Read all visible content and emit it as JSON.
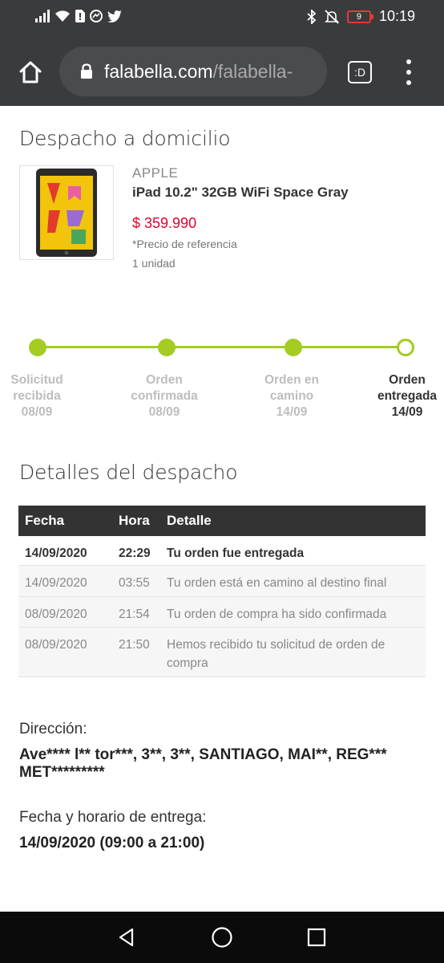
{
  "status_bar": {
    "time": "10:19",
    "battery": "9",
    "left_icons": [
      "signal-icon",
      "wifi-icon",
      "sim-icon",
      "messenger-icon",
      "twitter-icon"
    ],
    "right_icons": [
      "bluetooth-icon",
      "mute-icon",
      "battery-icon"
    ]
  },
  "browser": {
    "url_host": "falabella.com",
    "url_path": "/falabella-",
    "tabs_label": ":D"
  },
  "page": {
    "title": "Despacho a domicilio",
    "product": {
      "brand": "APPLE",
      "name": "iPad 10.2\" 32GB WiFi Space Gray",
      "price": "$ 359.990",
      "price_note": "*Precio de referencia",
      "quantity": "1 unidad"
    },
    "tracker": {
      "steps": [
        {
          "label1": "Solicitud",
          "label2": "recibida",
          "date": "08/09",
          "done": true
        },
        {
          "label1": "Orden",
          "label2": "confirmada",
          "date": "08/09",
          "done": true
        },
        {
          "label1": "Orden en",
          "label2": "camino",
          "date": "14/09",
          "done": true
        },
        {
          "label1": "Orden",
          "label2": "entregada",
          "date": "14/09",
          "done": false
        }
      ]
    },
    "details_title": "Detalles del despacho",
    "table": {
      "headers": {
        "fecha": "Fecha",
        "hora": "Hora",
        "detalle": "Detalle"
      },
      "rows": [
        {
          "fecha": "14/09/2020",
          "hora": "22:29",
          "detalle": "Tu orden fue entregada"
        },
        {
          "fecha": "14/09/2020",
          "hora": "03:55",
          "detalle": "Tu orden está en camino al destino final"
        },
        {
          "fecha": "08/09/2020",
          "hora": "21:54",
          "detalle": "Tu orden de compra ha sido confirmada"
        },
        {
          "fecha": "08/09/2020",
          "hora": "21:50",
          "detalle": "Hemos recibido tu solicitud de orden de compra"
        }
      ]
    },
    "address": {
      "label": "Dirección:",
      "value": "Ave**** l** tor***, 3**, 3**, SANTIAGO, MAI**, REG*** MET*********"
    },
    "delivery": {
      "label": "Fecha y horario de entrega:",
      "value": "14/09/2020 (09:00 a 21:00)"
    }
  },
  "colors": {
    "accent_green": "#a4cc22",
    "price_red": "#e4002b",
    "header_dark": "#333333",
    "chrome_bg": "#3a3b3d"
  }
}
